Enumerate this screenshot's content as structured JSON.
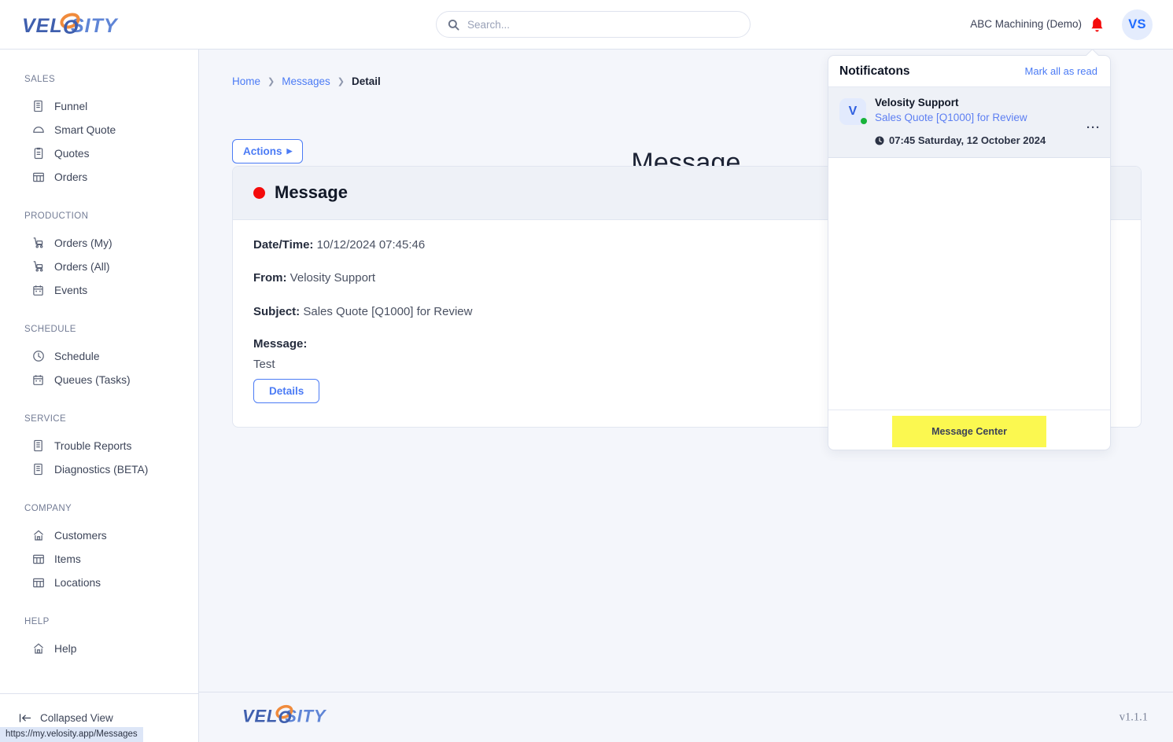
{
  "app": {
    "logo_text": "VELOSITY",
    "version": "v1.1.1"
  },
  "header": {
    "search_placeholder": "Search...",
    "search_value": "",
    "org_name": "ABC Machining (Demo)",
    "avatar_initials": "VS",
    "bell_color": "#f40b0b"
  },
  "sidebar": {
    "groups": [
      {
        "title": "SALES",
        "items": [
          {
            "label": "Funnel",
            "icon": "building-icon"
          },
          {
            "label": "Smart Quote",
            "icon": "cloud-icon"
          },
          {
            "label": "Quotes",
            "icon": "clipboard-icon"
          },
          {
            "label": "Orders",
            "icon": "grid-table-icon"
          }
        ]
      },
      {
        "title": "PRODUCTION",
        "items": [
          {
            "label": "Orders (My)",
            "icon": "cart-icon"
          },
          {
            "label": "Orders (All)",
            "icon": "cart-icon"
          },
          {
            "label": "Events",
            "icon": "calendar-icon"
          }
        ]
      },
      {
        "title": "SCHEDULE",
        "items": [
          {
            "label": "Schedule",
            "icon": "clock-icon"
          },
          {
            "label": "Queues (Tasks)",
            "icon": "calendar-icon"
          }
        ]
      },
      {
        "title": "SERVICE",
        "items": [
          {
            "label": "Trouble Reports",
            "icon": "building-icon"
          },
          {
            "label": "Diagnostics (BETA)",
            "icon": "building-icon"
          }
        ]
      },
      {
        "title": "COMPANY",
        "items": [
          {
            "label": "Customers",
            "icon": "home-icon"
          },
          {
            "label": "Items",
            "icon": "grid-table-icon"
          },
          {
            "label": "Locations",
            "icon": "grid-table-icon"
          }
        ]
      },
      {
        "title": "HELP",
        "items": [
          {
            "label": "Help",
            "icon": "home-icon"
          }
        ]
      }
    ],
    "collapse_label": "Collapsed View"
  },
  "main": {
    "breadcrumb": {
      "home": "Home",
      "messages": "Messages",
      "current": "Detail"
    },
    "page_title": "Message",
    "actions_label": "Actions",
    "card": {
      "title": "Message",
      "status_color": "#f40b0b",
      "fields": [
        {
          "label": "Date/Time:",
          "value": "10/12/2024 07:45:46"
        },
        {
          "label": "From:",
          "value": "Velosity Support"
        },
        {
          "label": "Subject:",
          "value": "Sales Quote [Q1000] for Review"
        }
      ],
      "message_label": "Message:",
      "message_text": "Test",
      "details_label": "Details"
    }
  },
  "notifications": {
    "title": "Notificatons",
    "mark_all_label": "Mark all as read",
    "items": [
      {
        "avatar_initial": "V",
        "from": "Velosity Support",
        "subject": "Sales Quote [Q1000] for Review",
        "time": "07:45 Saturday, 12 October 2024",
        "more_label": "···",
        "online": true
      }
    ],
    "message_center_label": "Message Center",
    "highlight_color": "#fbf850"
  },
  "status_bar": {
    "url": "https://my.velosity.app/Messages"
  }
}
